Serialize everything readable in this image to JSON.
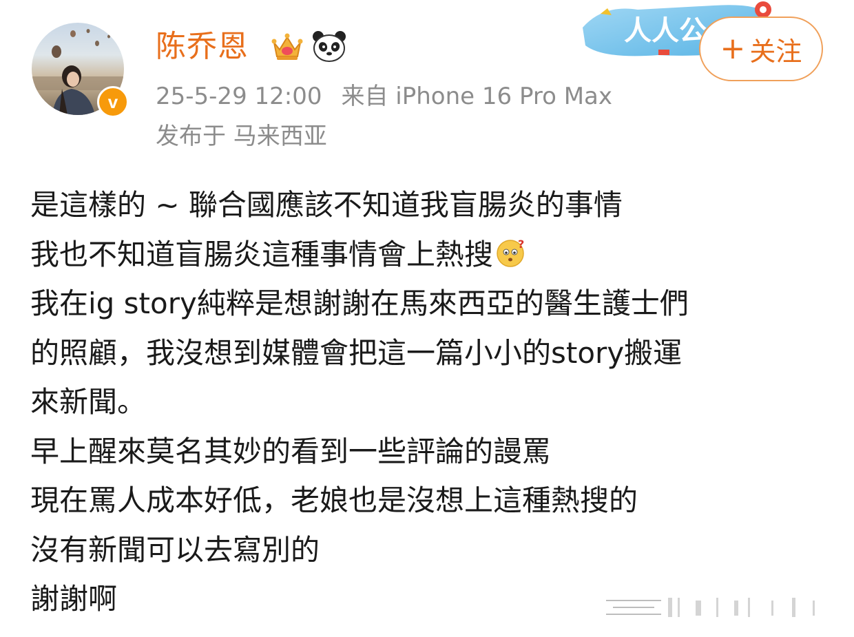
{
  "post": {
    "author": {
      "name": "陈乔恩",
      "verified_badge": "v",
      "avatar_icon": "avatar-photo",
      "badges": [
        "crown-icon",
        "panda-icon"
      ]
    },
    "meta": {
      "timestamp": "25-5-29 12:00",
      "source": "来自 iPhone 16 Pro Max",
      "location": "发布于 马来西亚"
    },
    "follow_button": {
      "label": "关注",
      "icon": "plus-icon"
    },
    "watermark_text": "人人公",
    "body_lines": [
      "是這樣的 ~ 聯合國應該不知道我盲腸炎的事情",
      "我也不知道盲腸炎這種事情會上熱搜",
      "我在ig story純粹是想謝謝在馬來西亞的醫生護士們",
      "的照顧，我沒想到媒體會把這一篇小小的story搬運",
      "來新聞。",
      "早上醒來莫名其妙的看到一些評論的謾罵",
      "現在罵人成本好低，老娘也是沒想上這種熱搜的",
      "沒有新聞可以去寫別的",
      "謝謝啊"
    ],
    "inline_emoji": "thinking-face-icon"
  },
  "colors": {
    "username": "#e86f1c",
    "meta": "#8c8c8c",
    "body_text": "#1a1a1a",
    "verified": "#f79a0b",
    "follow_border": "#f0a05a"
  }
}
